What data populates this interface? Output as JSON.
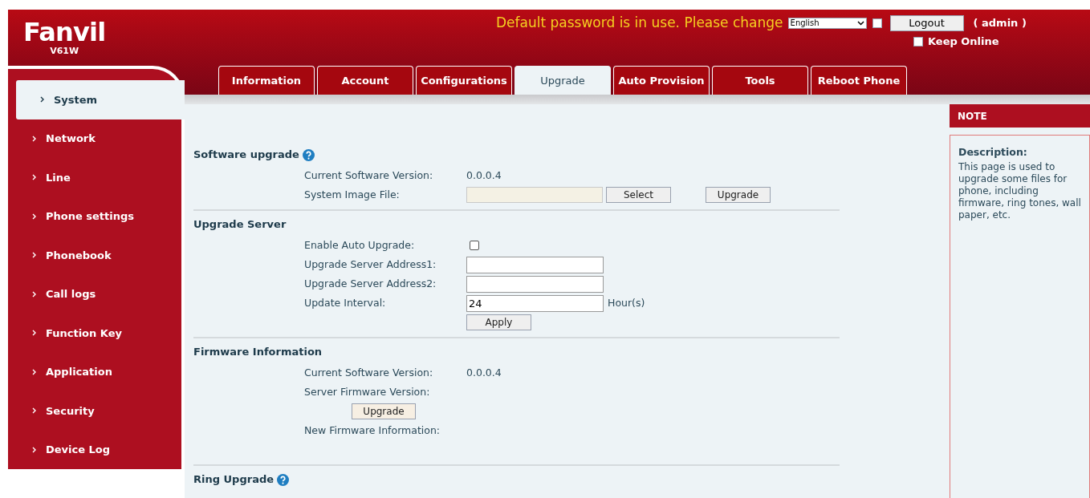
{
  "header": {
    "brand": "Fanvil",
    "model": "V61W",
    "warning": "Default password is in use. Please change",
    "language": "English",
    "option_checked": false,
    "logout": "Logout",
    "user": "( admin )",
    "keep_online": {
      "label": "Keep Online",
      "checked": false
    }
  },
  "tabs": [
    {
      "label": "Information",
      "selected": false
    },
    {
      "label": "Account",
      "selected": false
    },
    {
      "label": "Configurations",
      "selected": false
    },
    {
      "label": "Upgrade",
      "selected": true
    },
    {
      "label": "Auto Provision",
      "selected": false
    },
    {
      "label": "Tools",
      "selected": false
    },
    {
      "label": "Reboot Phone",
      "selected": false
    }
  ],
  "sidebar": {
    "items": [
      {
        "label": "System",
        "selected": true
      },
      {
        "label": "Network",
        "selected": false
      },
      {
        "label": "Line",
        "selected": false
      },
      {
        "label": "Phone settings",
        "selected": false
      },
      {
        "label": "Phonebook",
        "selected": false
      },
      {
        "label": "Call logs",
        "selected": false
      },
      {
        "label": "Function Key",
        "selected": false
      },
      {
        "label": "Application",
        "selected": false
      },
      {
        "label": "Security",
        "selected": false
      },
      {
        "label": "Device Log",
        "selected": false
      }
    ]
  },
  "sections": [
    {
      "title": "Software upgrade",
      "help": true,
      "rows": [
        {
          "kind": "text",
          "label": "Current Software Version:",
          "value": "0.0.0.4"
        },
        {
          "kind": "file",
          "label": "System Image File:",
          "buttons": [
            "Select",
            "Upgrade"
          ]
        }
      ]
    },
    {
      "title": "Upgrade Server",
      "help": false,
      "rows": [
        {
          "kind": "checkbox",
          "label": "Enable Auto Upgrade:",
          "checked": false
        },
        {
          "kind": "input",
          "label": "Upgrade Server Address1:"
        },
        {
          "kind": "input",
          "label": "Upgrade Server Address2:"
        },
        {
          "kind": "input",
          "label": "Update Interval:",
          "value": "24",
          "unit": "Hour(s)"
        },
        {
          "kind": "apply",
          "button": "Apply"
        }
      ]
    },
    {
      "title": "Firmware Information",
      "help": false,
      "rows": [
        {
          "kind": "text",
          "label": "Current Software Version:",
          "value": "0.0.0.4"
        },
        {
          "kind": "text",
          "label": "Server Firmware Version:"
        },
        {
          "kind": "center_button",
          "button": "Upgrade"
        },
        {
          "kind": "text",
          "label": "New Firmware Information:"
        }
      ]
    },
    {
      "title": "Ring Upgrade",
      "help": true
    }
  ],
  "note": {
    "title": "NOTE",
    "heading": "Description:",
    "body": "This page is used to upgrade some files for phone, including firmware, ring tones, wall paper, etc."
  }
}
